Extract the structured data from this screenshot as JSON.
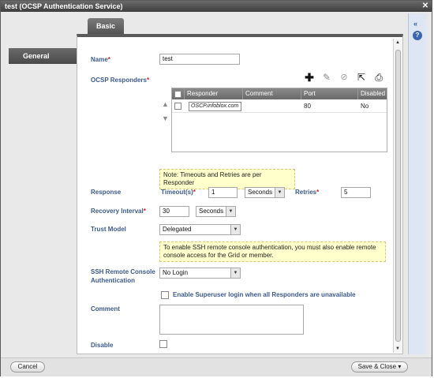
{
  "window": {
    "title": "test (OCSP Authentication Service)",
    "close_icon": "close-icon"
  },
  "nav": {
    "items": [
      {
        "label": "General"
      }
    ]
  },
  "tabs": [
    {
      "label": "Basic"
    }
  ],
  "form": {
    "name": {
      "label": "Name",
      "value": "test"
    },
    "responders": {
      "label": "OCSP Responders",
      "toolbar": [
        "add-icon",
        "edit-icon",
        "delete-icon",
        "export-icon",
        "print-icon"
      ],
      "columns": [
        "Responder",
        "Comment",
        "Port",
        "Disabled"
      ],
      "rows": [
        {
          "responder": "OSCP.infoblox.com",
          "comment": "",
          "port": "80",
          "disabled": "No"
        }
      ]
    },
    "note_timeouts": "Note: Timeouts and Retries are per Responder",
    "response": {
      "label": "Response",
      "timeout_label": "Timeout(s)",
      "timeout_value": "1",
      "timeout_unit": "Seconds",
      "retries_label": "Retries",
      "retries_value": "5"
    },
    "recovery": {
      "label": "Recovery Interval",
      "value": "30",
      "unit": "Seconds"
    },
    "trust": {
      "label": "Trust Model",
      "value": "Delegated"
    },
    "note_ssh": "To enable SSH remote console authentication, you must also enable remote console access for the Grid or member.",
    "ssh": {
      "label_line1": "SSH Remote Console",
      "label_line2": "Authentication",
      "value": "No Login"
    },
    "superuser": {
      "label": "Enable Superuser login when all Responders are unavailable"
    },
    "comment": {
      "label": "Comment",
      "value": ""
    },
    "disable": {
      "label": "Disable"
    }
  },
  "footer": {
    "cancel": "Cancel",
    "save": "Save & Close",
    "save_arrow": "▾"
  },
  "colors": {
    "accent": "#3c5a8a",
    "required": "#d02020",
    "note_bg": "#ffffcc"
  }
}
